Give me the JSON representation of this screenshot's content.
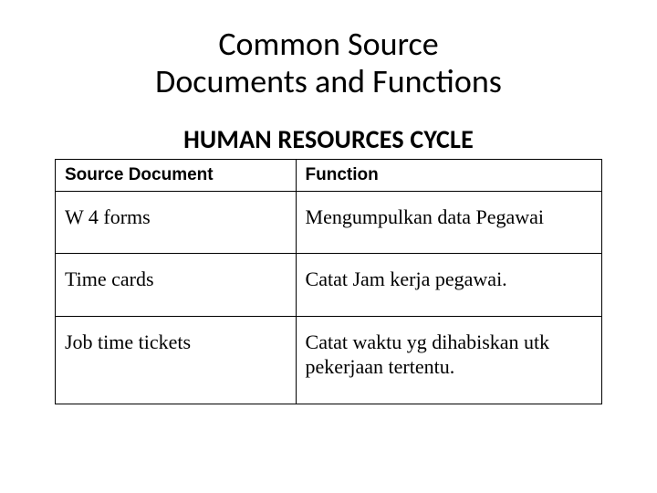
{
  "title_line1": "Common Source",
  "title_line2": "Documents and Functions",
  "subtitle": "HUMAN RESOURCES CYCLE",
  "table": {
    "headers": {
      "col1": "Source Document",
      "col2": "Function"
    },
    "rows": [
      {
        "doc": "W 4 forms",
        "func": "Mengumpulkan data Pegawai"
      },
      {
        "doc": "Time cards",
        "func": "Catat Jam kerja pegawai."
      },
      {
        "doc": "Job time tickets",
        "func": "Catat waktu yg dihabiskan utk pekerjaan tertentu."
      }
    ]
  }
}
